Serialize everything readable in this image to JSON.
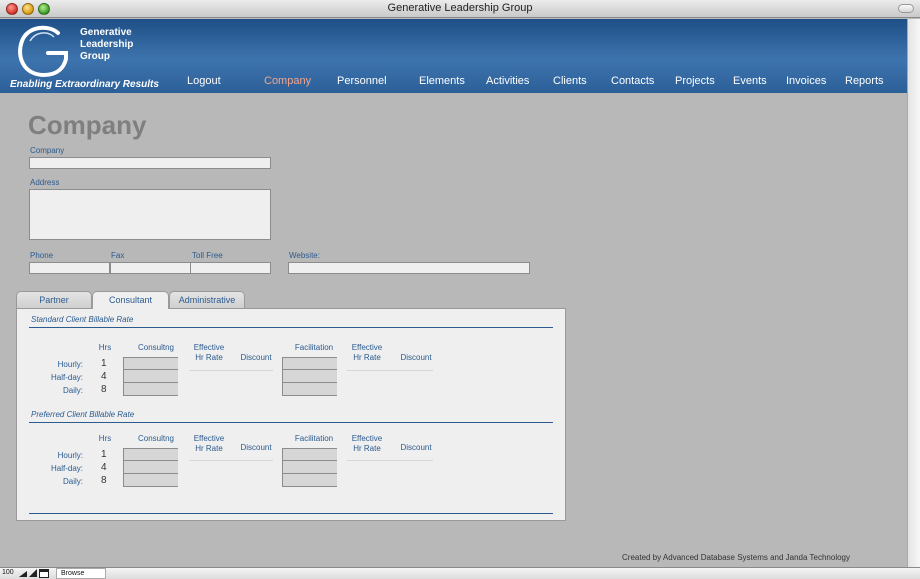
{
  "window": {
    "title": "Generative Leadership Group"
  },
  "logo": {
    "line1": "Generative",
    "line2": "Leadership",
    "line3": "Group",
    "tagline": "Enabling Extraordinary Results"
  },
  "nav": [
    {
      "label": "Logout"
    },
    {
      "label": "Company",
      "active": true
    },
    {
      "label": "Personnel"
    },
    {
      "label": "Elements"
    },
    {
      "label": "Activities"
    },
    {
      "label": "Clients"
    },
    {
      "label": "Contacts"
    },
    {
      "label": "Projects"
    },
    {
      "label": "Events"
    },
    {
      "label": "Invoices"
    },
    {
      "label": "Reports"
    }
  ],
  "page": {
    "title": "Company",
    "company_label": "Company",
    "company_value": "",
    "address_label": "Address",
    "address_value": "",
    "phone_label": "Phone",
    "phone_value": "",
    "fax_label": "Fax",
    "fax_value": "",
    "tollfree_label": "Toll Free",
    "tollfree_value": "",
    "website_label": "Website:",
    "website_value": ""
  },
  "tabs": [
    {
      "label": "Partner"
    },
    {
      "label": "Consultant",
      "active": true
    },
    {
      "label": "Administrative"
    }
  ],
  "rates": {
    "headers": {
      "hrs": "Hrs",
      "consulting": "Consultng",
      "eff1_line1": "Effective",
      "eff1_line2": "Hr Rate",
      "discount": "Discount",
      "facilitation": "Facilitation",
      "eff2_line1": "Effective",
      "eff2_line2": "Hr Rate"
    },
    "sections": [
      {
        "title": "Standard Client Billable Rate",
        "rows": [
          {
            "label": "Hourly:",
            "hrs": "1"
          },
          {
            "label": "Half-day:",
            "hrs": "4"
          },
          {
            "label": "Daily:",
            "hrs": "8"
          }
        ]
      },
      {
        "title": "Preferred Client Billable Rate",
        "rows": [
          {
            "label": "Hourly:",
            "hrs": "1"
          },
          {
            "label": "Half-day:",
            "hrs": "4"
          },
          {
            "label": "Daily:",
            "hrs": "8"
          }
        ]
      }
    ]
  },
  "footer": {
    "credit": "Created by Advanced Database Systems and Janda Technology"
  },
  "statusbar": {
    "zoom": "100",
    "mode": "Browse"
  },
  "colors": {
    "header": "#2b5f98",
    "accent": "#2b5b8f",
    "active_nav": "#f1a58f",
    "background": "#b8b8b8"
  }
}
